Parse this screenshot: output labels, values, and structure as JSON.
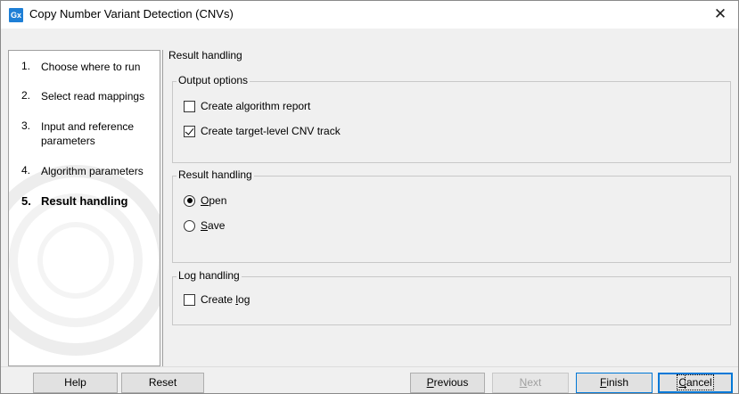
{
  "window": {
    "app_icon_text": "Gx",
    "title": "Copy Number Variant Detection (CNVs)",
    "close_glyph": "✕"
  },
  "sidebar": {
    "steps": [
      {
        "num": "1.",
        "label": "Choose where to run"
      },
      {
        "num": "2.",
        "label": "Select read mappings"
      },
      {
        "num": "3.",
        "label": "Input and reference parameters"
      },
      {
        "num": "4.",
        "label": "Algorithm parameters"
      },
      {
        "num": "5.",
        "label": "Result handling",
        "active": true
      }
    ]
  },
  "main": {
    "header": "Result handling",
    "output_options": {
      "legend": "Output options",
      "algorithm_report": {
        "label": "Create algorithm report",
        "checked": false
      },
      "cnv_track": {
        "label": "Create target-level CNV track",
        "checked": true
      }
    },
    "result_handling": {
      "legend": "Result handling",
      "open": {
        "label": "Open",
        "mnemonic": "O",
        "rest": "pen",
        "selected": true
      },
      "save": {
        "label": "Save",
        "mnemonic": "S",
        "rest": "ave",
        "selected": false
      }
    },
    "log_handling": {
      "legend": "Log handling",
      "create_log": {
        "label": "Create log",
        "prefix": "Create ",
        "mnemonic": "l",
        "rest": "og",
        "checked": false
      }
    }
  },
  "footer": {
    "help": "Help",
    "reset": "Reset",
    "previous": {
      "label": "Previous",
      "mnemonic": "P",
      "rest": "revious"
    },
    "next": {
      "label": "Next",
      "mnemonic": "N",
      "rest": "ext",
      "disabled": true
    },
    "finish": {
      "label": "Finish",
      "mnemonic": "F",
      "rest": "inish"
    },
    "cancel": {
      "label": "Cancel",
      "mnemonic": "C",
      "rest": "ancel"
    }
  },
  "colors": {
    "app_icon_bg": "#1e7fd6",
    "focus_border": "#0078d7"
  }
}
